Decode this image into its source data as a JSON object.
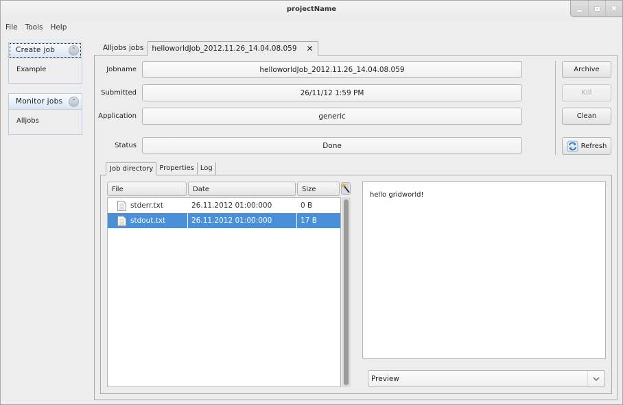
{
  "window": {
    "title": "projectName",
    "controls": [
      "minimize",
      "maximize",
      "close"
    ]
  },
  "menu": [
    "File",
    "Tools",
    "Help"
  ],
  "sidebar": {
    "panels": [
      {
        "title": "Create job",
        "items": [
          "Example"
        ],
        "icon": "collapse-up-icon"
      },
      {
        "title": "Monitor jobs",
        "items": [
          "Alljobs"
        ],
        "icon": "collapse-up-icon"
      }
    ]
  },
  "tabs": {
    "items": [
      {
        "label": "Alljobs jobs",
        "active": false
      },
      {
        "label": "helloworldJob_2012.11.26_14.04.08.059",
        "active": true,
        "closable": true
      }
    ],
    "close_glyph": "✕"
  },
  "job": {
    "fields": [
      {
        "label": "Jobname",
        "value": "helloworldJob_2012.11.26_14.04.08.059"
      },
      {
        "label": "Submitted",
        "value": "26/11/12 1:59 PM"
      },
      {
        "label": "Application",
        "value": "generic"
      },
      {
        "label": "Status",
        "value": "Done"
      }
    ],
    "buttons": [
      {
        "label": "Archive",
        "enabled": true
      },
      {
        "label": "Kill",
        "enabled": false
      },
      {
        "label": "Clean",
        "enabled": true
      },
      {
        "label": "Refresh",
        "enabled": true,
        "icon": "refresh-icon"
      }
    ]
  },
  "inner_tabs": [
    {
      "label": "Job directory",
      "active": true
    },
    {
      "label": "Properties",
      "active": false
    },
    {
      "label": "Log",
      "active": false
    }
  ],
  "file_table": {
    "columns": [
      "File",
      "Date",
      "Size"
    ],
    "rows": [
      {
        "file": "stderr.txt",
        "date": "26.11.2012 01:00:000",
        "size": "0 B",
        "selected": false
      },
      {
        "file": "stdout.txt",
        "date": "26.11.2012 01:00:000",
        "size": "17 B",
        "selected": true
      }
    ]
  },
  "preview": {
    "content": "hello gridworld!",
    "mode": "Preview"
  },
  "colors": {
    "selection": "#4a90d9",
    "sidebar_header": "#d9e6f3"
  }
}
